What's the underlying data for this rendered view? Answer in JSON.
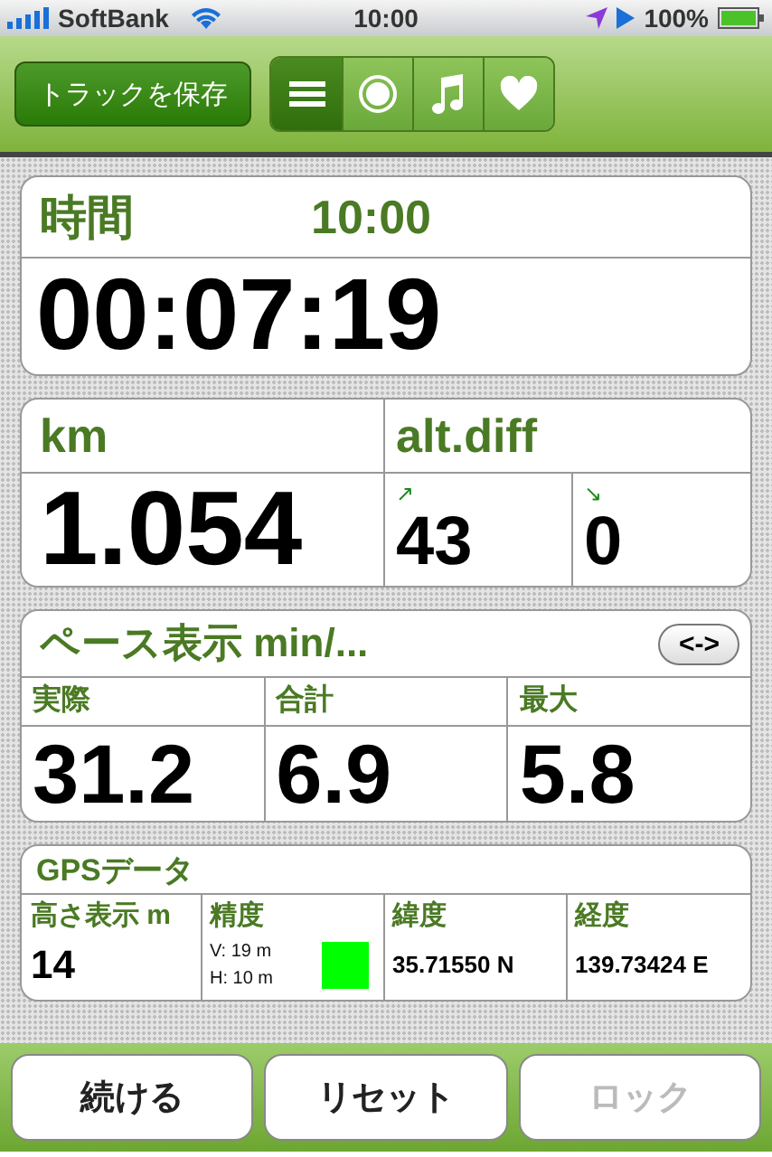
{
  "status_bar": {
    "carrier": "SoftBank",
    "time": "10:00",
    "battery": "100%"
  },
  "toolbar": {
    "save_button": "トラックを保存",
    "segments": [
      {
        "kind": "list",
        "selected": true
      },
      {
        "kind": "record",
        "selected": false
      },
      {
        "kind": "music",
        "selected": false
      },
      {
        "kind": "heart",
        "selected": false
      }
    ]
  },
  "time_card": {
    "label": "時間",
    "clock": "10:00",
    "value": "00:07:19"
  },
  "distance_card": {
    "label": "km",
    "value": "1.054",
    "alt_label": "alt.diff",
    "up_icon": "↗",
    "up": "43",
    "down_icon": "↘",
    "down": "0"
  },
  "pace_card": {
    "label": "ペース表示 min/...",
    "toggle": "<->",
    "columns": [
      {
        "label": "実際",
        "value": "31.2"
      },
      {
        "label": "合計",
        "value": "6.9"
      },
      {
        "label": "最大",
        "value": "5.8"
      }
    ]
  },
  "gps_card": {
    "label": "GPSデータ",
    "altitude_label": "高さ表示 m",
    "altitude": "14",
    "accuracy_label": "精度",
    "accuracy_v": "V: 19 m",
    "accuracy_h": "H: 10 m",
    "accuracy_indicator": {
      "color": "#00ff00"
    },
    "lat_label": "緯度",
    "lat": "35.71550 N",
    "lon_label": "経度",
    "lon": "139.73424 E"
  },
  "buttons": [
    {
      "label": "続ける",
      "disabled": false
    },
    {
      "label": "リセット",
      "disabled": false
    },
    {
      "label": "ロック",
      "disabled": true
    }
  ]
}
